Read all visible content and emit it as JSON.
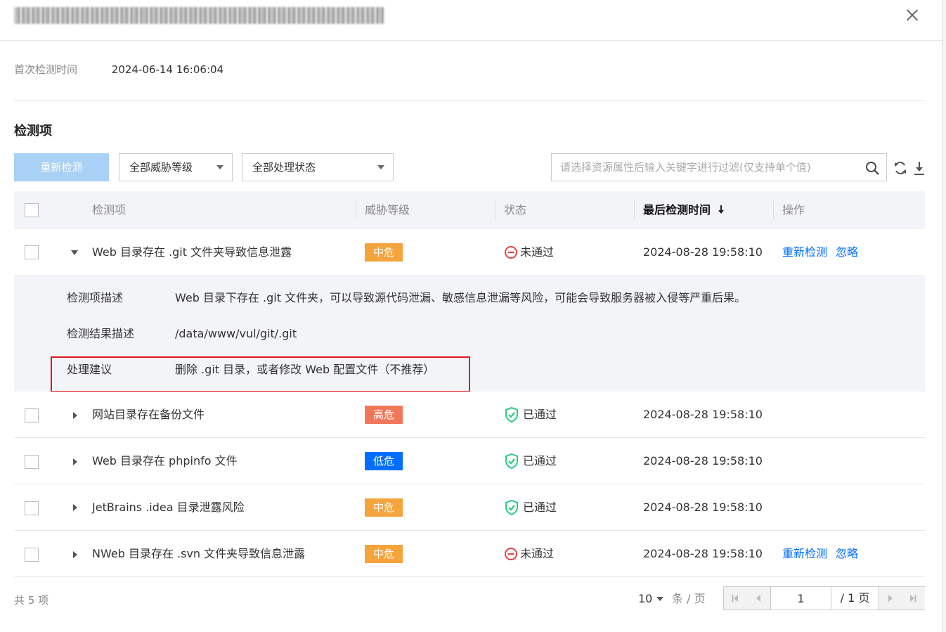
{
  "dialog": {
    "first_detect_label": "首次检测时间",
    "first_detect_value": "2024-06-14 16:06:04"
  },
  "section": {
    "title": "检测项"
  },
  "toolbar": {
    "recheck_label": "重新检测",
    "threat_filter": "全部威胁等级",
    "status_filter": "全部处理状态",
    "search_placeholder": "请选择资源属性后输入关键字进行过滤(仅支持单个值)"
  },
  "table": {
    "headers": {
      "item": "检测项",
      "threat": "威胁等级",
      "status": "状态",
      "last_time": "最后检测时间",
      "action": "操作"
    },
    "rows": [
      {
        "name": "Web 目录存在 .git 文件夹导致信息泄露",
        "threat": "中危",
        "status": "未通过",
        "time": "2024-08-28 19:58:10",
        "recheck": "重新检测",
        "ignore": "忽略"
      },
      {
        "name": "网站目录存在备份文件",
        "threat": "高危",
        "status": "已通过",
        "time": "2024-08-28 19:58:10"
      },
      {
        "name": "Web 目录存在 phpinfo 文件",
        "threat": "低危",
        "status": "已通过",
        "time": "2024-08-28 19:58:10"
      },
      {
        "name": "JetBrains .idea 目录泄露风险",
        "threat": "中危",
        "status": "已通过",
        "time": "2024-08-28 19:58:10"
      },
      {
        "name": "NWeb 目录存在 .svn 文件夹导致信息泄露",
        "threat": "中危",
        "status": "未通过",
        "time": "2024-08-28 19:58:10",
        "recheck": "重新检测",
        "ignore": "忽略"
      }
    ],
    "detail": {
      "desc_label": "检测项描述",
      "desc_value": "Web 目录下存在 .git 文件夹，可以导致源代码泄漏、敏感信息泄漏等风险，可能会导致服务器被入侵等严重后果。",
      "result_label": "检测结果描述",
      "result_value": "/data/www/vul/git/.git",
      "advice_label": "处理建议",
      "advice_value": "删除 .git 目录，或者修改 Web 配置文件（不推荐）"
    }
  },
  "colors": {
    "medium": "#f5a33b",
    "high": "#f0785a",
    "low": "#006eff",
    "fail": "#e54545",
    "pass": "#29cc85",
    "link": "#006eff"
  },
  "footer": {
    "total": "共 5 项",
    "page_size": "10",
    "per_page": "条 / 页",
    "current_page": "1",
    "total_pages": "/ 1 页"
  }
}
